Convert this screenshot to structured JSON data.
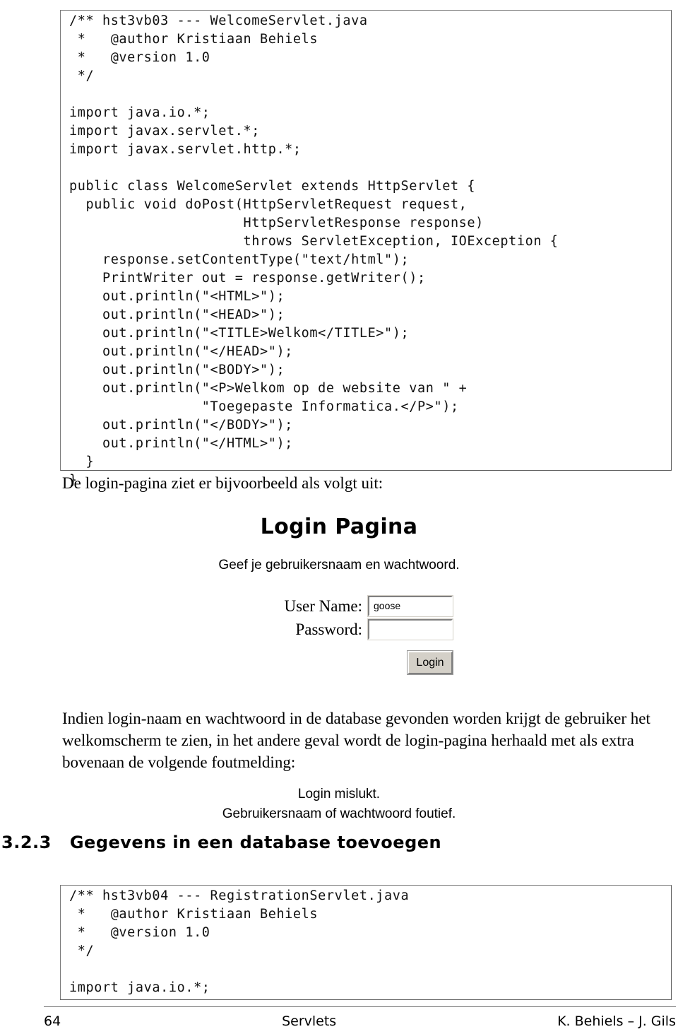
{
  "code_block_1": {
    "name": "WelcomeServlet.java source listing",
    "lines": [
      "/** hst3vb03 --- WelcomeServlet.java",
      " *   @author Kristiaan Behiels",
      " *   @version 1.0",
      " */",
      "",
      "import java.io.*;",
      "import javax.servlet.*;",
      "import javax.servlet.http.*;",
      "",
      "public class WelcomeServlet extends HttpServlet {",
      "  public void doPost(HttpServletRequest request,",
      "                     HttpServletResponse response)",
      "                     throws ServletException, IOException {",
      "    response.setContentType(\"text/html\");",
      "    PrintWriter out = response.getWriter();",
      "    out.println(\"<HTML>\");",
      "    out.println(\"<HEAD>\");",
      "    out.println(\"<TITLE>Welkom</TITLE>\");",
      "    out.println(\"</HEAD>\");",
      "    out.println(\"<BODY>\");",
      "    out.println(\"<P>Welkom op de website van \" +",
      "                \"Toegepaste Informatica.</P>\");",
      "    out.println(\"</BODY>\");",
      "    out.println(\"</HTML>\");",
      "  }",
      "}"
    ]
  },
  "intro_line": "De login-pagina ziet er bijvoorbeeld als volgt uit:",
  "login_mock": {
    "title": "Login Pagina",
    "subtitle": "Geef je gebruikersnaam en wachtwoord.",
    "username_label": "User Name:",
    "username_value": "goose",
    "username_placeholder": "",
    "password_label": "Password:",
    "password_value": "",
    "password_placeholder": "",
    "submit_label": "Login"
  },
  "explain_para": "Indien login-naam en wachtwoord in de database gevonden worden krijgt de gebruiker het welkomscherm te zien, in het andere geval wordt de login-pagina herhaald met als extra bovenaan de volgende foutmelding:",
  "error_mock": {
    "line1": "Login mislukt.",
    "line2": "Gebruikersnaam of wachtwoord foutief."
  },
  "section_heading": {
    "number": "3.2.3",
    "title": "Gegevens in een database toevoegen"
  },
  "code_block_2": {
    "name": "RegistrationServlet.java source listing",
    "lines": [
      "/** hst3vb04 --- RegistrationServlet.java",
      " *   @author Kristiaan Behiels",
      " *   @version 1.0",
      " */",
      "",
      "import java.io.*;"
    ]
  },
  "footer": {
    "page_number": "64",
    "center": "Servlets",
    "author": "K. Behiels – J. Gils"
  }
}
